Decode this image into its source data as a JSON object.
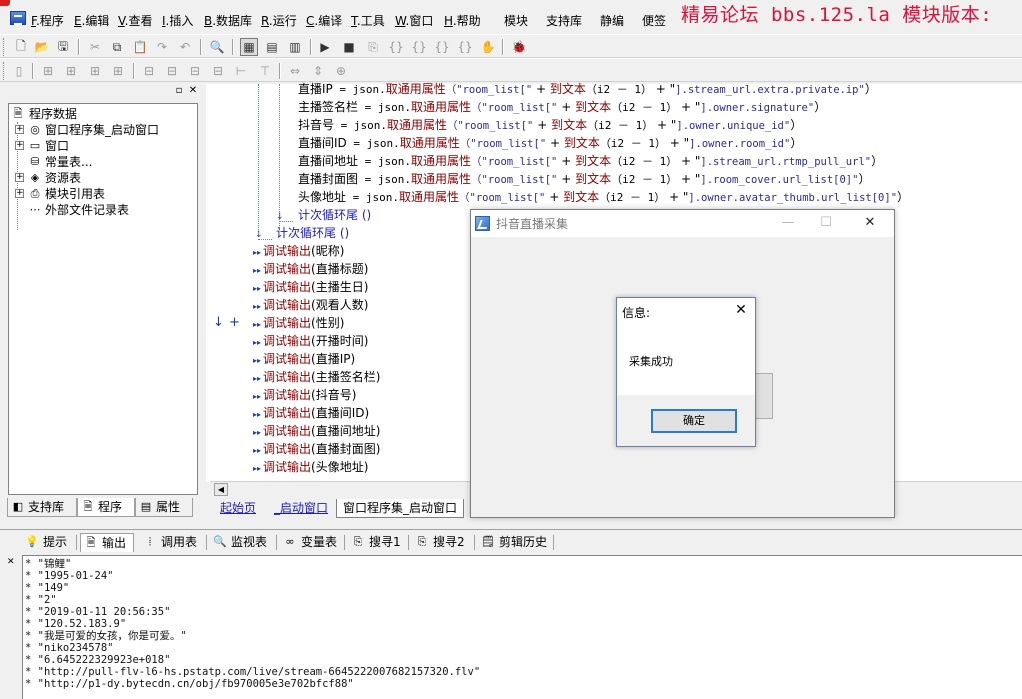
{
  "menubar": {
    "items": [
      {
        "key": "F",
        "label": ".程序"
      },
      {
        "key": "E",
        "label": ".编辑"
      },
      {
        "key": "V",
        "label": ".查看"
      },
      {
        "key": "I",
        "label": ".插入"
      },
      {
        "key": "B",
        "label": ".数据库"
      },
      {
        "key": "R",
        "label": ".运行"
      },
      {
        "key": "C",
        "label": ".编译"
      },
      {
        "key": "T",
        "label": ".工具"
      },
      {
        "key": "W",
        "label": ".窗口"
      },
      {
        "key": "H",
        "label": ".帮助"
      }
    ],
    "extra": [
      "模块",
      "支持库",
      "静编",
      "便签"
    ],
    "banner": "精易论坛 bbs.125.la 模块版本:"
  },
  "left_panel": {
    "tree": {
      "root": "程序数据",
      "items": [
        {
          "label": "窗口程序集_启动窗口",
          "icon": "module-icon"
        },
        {
          "label": "窗口",
          "icon": "window-icon"
        },
        {
          "label": "常量表...",
          "icon": "constant-icon"
        },
        {
          "label": "资源表",
          "icon": "resource-icon"
        },
        {
          "label": "模块引用表",
          "icon": "module-ref-icon"
        },
        {
          "label": "外部文件记录表",
          "icon": "file-record-icon"
        }
      ]
    },
    "tabs": [
      {
        "label": "支持库"
      },
      {
        "label": "程序"
      },
      {
        "label": "属性"
      }
    ]
  },
  "editor": {
    "assign_lines": [
      {
        "var": "直播IP",
        "path": "].stream_url.extra.private.ip\""
      },
      {
        "var": "主播签名栏",
        "path": "].owner.signature\""
      },
      {
        "var": "抖音号",
        "path": "].owner.unique_id\""
      },
      {
        "var": "直播间ID",
        "path": "].owner.room_id\""
      },
      {
        "var": "直播间地址",
        "path": "].stream_url.rtmp_pull_url\""
      },
      {
        "var": "直播封面图",
        "path": "].room_cover.url_list[0]\""
      },
      {
        "var": "头像地址",
        "path": "].owner.avatar_thumb.url_list[0]\""
      }
    ],
    "assign_mid": " = json.",
    "assign_fn": "取通用属性",
    "assign_arg_open": "（\"room_list[\"",
    "assign_plus1": " + ",
    "assign_to_text": "到文本",
    "assign_i2": "（i2 － 1）",
    "assign_plus2": " + \"",
    "loop_end_inner": "计次循环尾 ()",
    "loop_end_outer": "计次循环尾 ()",
    "debug_fn": "调试输出",
    "debug_args": [
      "(昵称)",
      "(直播标题)",
      "(主播生日)",
      "(观看人数)",
      "(性别)",
      "(开播时间)",
      "(直播IP)",
      "(主播签名栏)",
      "(抖音号)",
      "(直播间ID)",
      "(直播间地址)",
      "(直播封面图)",
      "(头像地址)"
    ],
    "tabs": [
      {
        "label": "起始页"
      },
      {
        "label": "_启动窗口"
      },
      {
        "label": "窗口程序集_启动窗口"
      }
    ]
  },
  "bottom": {
    "tabs": [
      {
        "label": "提示",
        "icon": "hint-icon"
      },
      {
        "label": "输出",
        "icon": "output-icon"
      },
      {
        "label": "调用表",
        "icon": "call-table-icon"
      },
      {
        "label": "监视表",
        "icon": "watch-icon"
      },
      {
        "label": "变量表",
        "icon": "variable-icon"
      },
      {
        "label": "搜寻1",
        "icon": "search1-icon"
      },
      {
        "label": "搜寻2",
        "icon": "search2-icon"
      },
      {
        "label": "剪辑历史",
        "icon": "clip-history-icon"
      }
    ],
    "output_lines": [
      "* \"锦鲤\"",
      "* \"1995-01-24\"",
      "* \"149\"",
      "* \"2\"",
      "* \"2019-01-11 20:56:35\"",
      "* \"120.52.183.9\"",
      "* \"我是可爱的女孩，你是可爱。\"",
      "* \"niko234578\"",
      "* \"6.645222329923e+018\"",
      "* \"http://pull-flv-l6-hs.pstatp.com/live/stream-6645222007682157320.flv\"",
      "* \"http://p1-dy.bytecdn.cn/obj/fb970005e3e702bfcf88\""
    ]
  },
  "app_window": {
    "title": "抖音直播采集"
  },
  "message_box": {
    "title": "信息:",
    "text": "采集成功",
    "ok_label": "确定"
  },
  "colors": {
    "banner_red": "#e0103a",
    "keyword_blue": "#1c1cc0",
    "function_red": "#8b0000"
  }
}
